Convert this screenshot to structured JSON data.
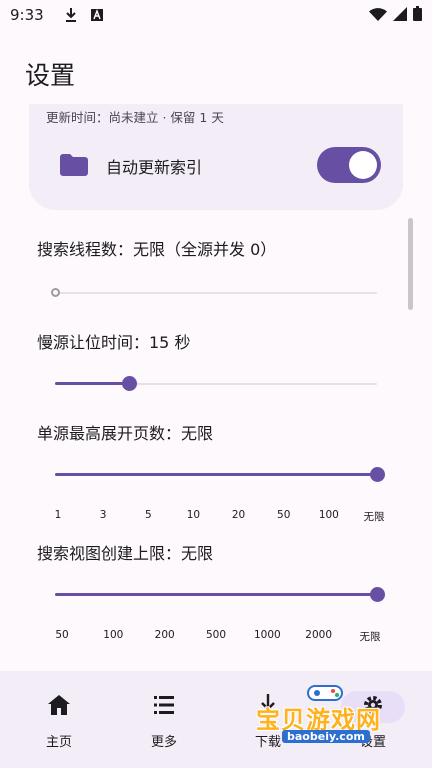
{
  "status_bar": {
    "time": "9:33",
    "icons": [
      "download-icon",
      "a-box-icon",
      "wifi-icon",
      "signal-icon",
      "battery-icon"
    ]
  },
  "page": {
    "title": "设置"
  },
  "index_card": {
    "update_text": "更新时间：尚未建立 · 保留 1 天",
    "auto_update_label": "自动更新索引",
    "auto_update_on": true,
    "icon": "folder-icon"
  },
  "settings": {
    "threads": {
      "label": "搜索线程数：无限（全源并发 0）",
      "value_fraction": 0
    },
    "slow_yield": {
      "label": "慢源让位时间：15 秒",
      "value_fraction": 0.23
    },
    "max_pages": {
      "label": "单源最高展开页数：无限",
      "value_fraction": 1,
      "ticks": [
        "1",
        "3",
        "5",
        "10",
        "20",
        "50",
        "100",
        "无限"
      ]
    },
    "view_limit": {
      "label": "搜索视图创建上限：无限",
      "value_fraction": 1,
      "ticks": [
        "50",
        "100",
        "200",
        "500",
        "1000",
        "2000",
        "无限"
      ]
    }
  },
  "bottom_nav": {
    "items": [
      {
        "label": "主页",
        "icon": "home-icon"
      },
      {
        "label": "更多",
        "icon": "list-icon"
      },
      {
        "label": "下载",
        "icon": "download-icon"
      },
      {
        "label": "设置",
        "icon": "gear-icon"
      }
    ],
    "active_index": 3
  },
  "watermark": {
    "text": "宝贝游戏网",
    "url": "baobeiy.com"
  },
  "colors": {
    "primary": "#6750a4",
    "surface_container": "#f3edf7",
    "background": "#fdf9fd"
  }
}
